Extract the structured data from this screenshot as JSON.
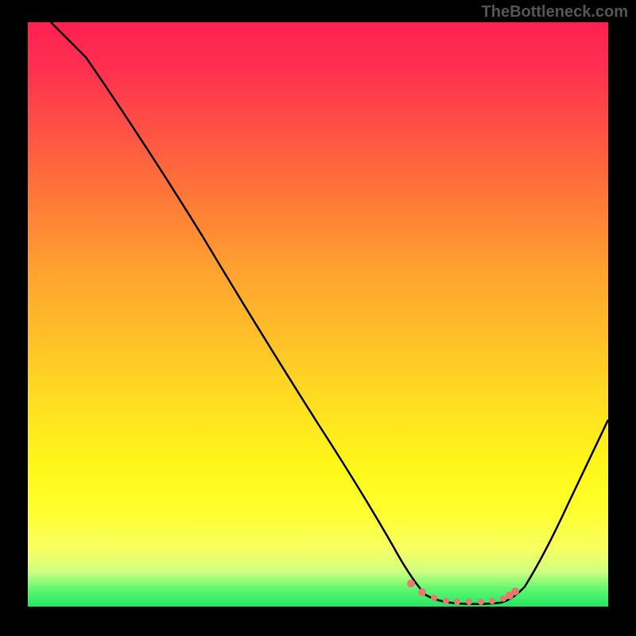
{
  "watermark": "TheBottleneck.com",
  "chart_data": {
    "type": "line",
    "title": "",
    "xlabel": "",
    "ylabel": "",
    "xlim": [
      0,
      100
    ],
    "ylim": [
      0,
      100
    ],
    "series": [
      {
        "name": "curve",
        "x": [
          4,
          10,
          20,
          30,
          40,
          50,
          60,
          66,
          70,
          74,
          78,
          82,
          86,
          90,
          94,
          100
        ],
        "y": [
          100,
          94,
          80,
          64,
          48,
          32,
          16,
          6,
          2,
          0.5,
          0.5,
          0.8,
          1.5,
          5,
          12,
          28
        ]
      }
    ],
    "markers": {
      "name": "dots",
      "x": [
        66,
        68,
        70,
        72,
        74,
        76,
        78,
        80,
        82,
        83,
        84
      ],
      "y": [
        4,
        2.5,
        1.5,
        1,
        0.8,
        0.8,
        0.8,
        1,
        1.3,
        1.8,
        2.5
      ],
      "color": "#e87870"
    },
    "gradient_stops": [
      {
        "pos": 0,
        "color": "#ff2050"
      },
      {
        "pos": 30,
        "color": "#ff7838"
      },
      {
        "pos": 66,
        "color": "#ffe020"
      },
      {
        "pos": 90,
        "color": "#f8ff60"
      },
      {
        "pos": 100,
        "color": "#20e860"
      }
    ]
  }
}
